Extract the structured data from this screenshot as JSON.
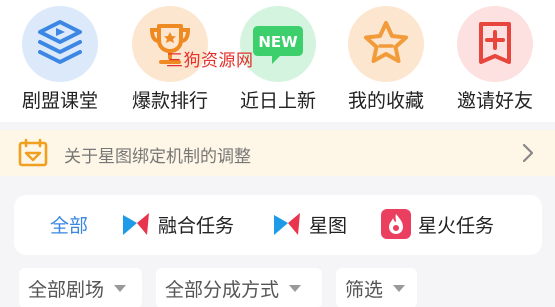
{
  "top_icons": [
    {
      "label": "剧盟课堂",
      "icon": "play-stack-icon",
      "bg": "#dbe9fb",
      "fg": "#3b87e3"
    },
    {
      "label": "爆款排行",
      "icon": "trophy-icon",
      "bg": "#fde6cf",
      "fg": "#ef8a22"
    },
    {
      "label": "近日上新",
      "icon": "new-badge-icon",
      "bg": "#d4f4df",
      "fg": "#3ccf6b"
    },
    {
      "label": "我的收藏",
      "icon": "star-icon",
      "bg": "#fde6cf",
      "fg": "#f29b3a"
    },
    {
      "label": "邀请好友",
      "icon": "invite-plus-icon",
      "bg": "#fde0e0",
      "fg": "#e8453c"
    }
  ],
  "new_badge_text": "NEW",
  "watermark": "三狗资源网",
  "notice": {
    "text": "关于星图绑定机制的调整",
    "icon": "calendar-icon",
    "accent": "#f0a020"
  },
  "categories": {
    "all": "全部",
    "items": [
      {
        "label": "融合任务",
        "icon": "xingtu-logo-icon"
      },
      {
        "label": "星图",
        "icon": "xingtu-logo-icon"
      },
      {
        "label": "星火任务",
        "icon": "xinghuo-logo-icon"
      }
    ]
  },
  "filters": [
    {
      "label": "全部剧场"
    },
    {
      "label": "全部分成方式"
    },
    {
      "label": "筛选"
    }
  ]
}
